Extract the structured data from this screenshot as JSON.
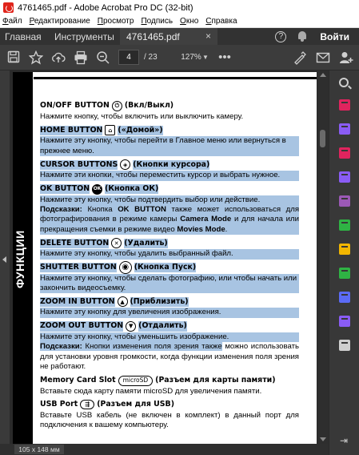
{
  "window": {
    "title": "4761465.pdf - Adobe Acrobat Pro DC (32-bit)"
  },
  "menu": [
    {
      "key": "Ф",
      "rest": "айл"
    },
    {
      "key": "Р",
      "rest": "едактирование"
    },
    {
      "key": "П",
      "rest": "росмотр"
    },
    {
      "key": "П",
      "rest": "одпись"
    },
    {
      "key": "О",
      "rest": "кно"
    },
    {
      "key": "С",
      "rest": "правка"
    }
  ],
  "tabs": {
    "home": "Главная",
    "tools": "Инструменты",
    "doc": "4761465.pdf",
    "close": "×",
    "signin": "Войти",
    "help": "?"
  },
  "toolbar": {
    "page_current": "4",
    "page_total": "/ 23",
    "zoom": "127%"
  },
  "page": {
    "vertical_label": "ФУНКЦИИ",
    "sections": [
      {
        "title": "ON/OFF BUTTON",
        "icon": "power-icon",
        "icon_glyph": "⏻",
        "suffix": "(Вкл/Выкл)",
        "desc": "Нажмите кнопку, чтобы включить или выключить камеру.",
        "highlight": false
      },
      {
        "title": "HOME BUTTON",
        "icon": "home-icon",
        "icon_glyph": "⌂",
        "suffix": "(«Домой»)",
        "desc": "Нажмите эту кнопку, чтобы перейти в Главное меню или вернуться в прежнее меню.",
        "highlight": true
      },
      {
        "title": "CURSOR BUTTONS",
        "icon": "cursor-icon",
        "icon_glyph": "◈",
        "suffix": "(Кнопки курсора)",
        "desc": "Нажмите эти кнопки, чтобы переместить курсор и выбрать нужное.",
        "highlight": true
      },
      {
        "title": "OK BUTTON",
        "icon": "ok-icon",
        "icon_glyph": "OK",
        "suffix": "(Кнопка ОК)",
        "desc": "Нажмите эту кнопку, чтобы подтвердить выбор или действие.",
        "highlight": true
      }
    ],
    "hint1": {
      "label": "Подсказки:",
      "text_a": "Кнопка",
      "bold_a": "OK BUTTON",
      "text_b": "также может использоваться для фотографирования в режиме камеры",
      "bold_b": "Camera Mode",
      "text_c": "и для начала или прекращения съемки в режиме видео",
      "bold_c": "Movies Mode",
      "end": "."
    },
    "sections2": [
      {
        "title": "DELETE BUTTON",
        "icon": "delete-icon",
        "icon_glyph": "✕",
        "suffix": "(Удалить)",
        "desc": "Нажмите эту кнопку, чтобы удалить выбранный файл.",
        "highlight": true
      },
      {
        "title": "SHUTTER BUTTON",
        "icon": "shutter-icon",
        "icon_glyph": "◉",
        "suffix": "(Кнопка Пуск)",
        "desc": "Нажмите эту кнопку, чтобы сделать фотографию, или чтобы начать или закончить видеосъемку.",
        "highlight": true
      },
      {
        "title": "ZOOM IN BUTTON",
        "icon": "zoom-in-icon",
        "icon_glyph": "▲",
        "suffix": "(Приблизить)",
        "desc": "Нажмите эту кнопку для увеличения изображения.",
        "highlight": true
      },
      {
        "title": "ZOOM OUT BUTTON",
        "icon": "zoom-out-icon",
        "icon_glyph": "▼",
        "suffix": "(Отдалить)",
        "desc": "Нажмите эту кнопку, чтобы уменьшить изображение.",
        "highlight": true
      }
    ],
    "hint2": {
      "label": "Подсказки:",
      "text_hl": "Кнопки изменения поля зрения также",
      "text": "можно использовать для установки уровня громкости, когда функции изменения поля зрения не работают."
    },
    "memory": {
      "title": "Memory Card Slot",
      "icon_text": "microSD",
      "suffix": "(Разъем для карты памяти)",
      "desc": "Вставьте сюда карту памяти microSD для увеличения памяти."
    },
    "usb": {
      "title": "USB Port",
      "icon_glyph": "⇶",
      "suffix": "(Разъем для USB)",
      "desc": "Вставьте USB кабель (не включен в комплект) в данный порт для подключения к вашему компьютеру."
    }
  },
  "status": {
    "page_size": "105 x 148 мм"
  },
  "right_tools": [
    {
      "name": "create-pdf-icon",
      "color": "#e0245e"
    },
    {
      "name": "combine-files-icon",
      "color": "#8a5cf5"
    },
    {
      "name": "edit-pdf-icon",
      "color": "#e0245e"
    },
    {
      "name": "export-pdf-icon",
      "color": "#8a5cf5"
    },
    {
      "name": "fill-sign-icon",
      "color": "#9b59b6"
    },
    {
      "name": "organize-pages-icon",
      "color": "#2fb344"
    },
    {
      "name": "comment-icon",
      "color": "#f2b600"
    },
    {
      "name": "print-production-icon",
      "color": "#2fb344"
    },
    {
      "name": "protect-icon",
      "color": "#5b6bf5"
    },
    {
      "name": "send-for-signature-icon",
      "color": "#8a5cf5"
    },
    {
      "name": "more-tools-icon",
      "color": "#cfcfcf"
    }
  ]
}
